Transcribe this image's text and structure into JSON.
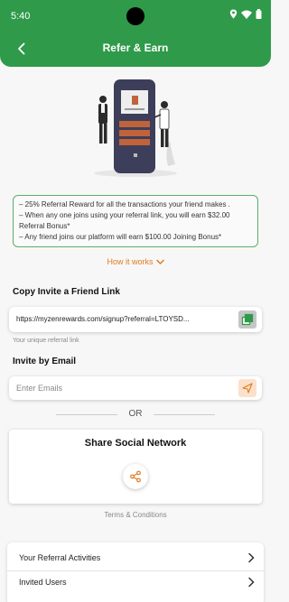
{
  "status_bar": {
    "time": "5:40"
  },
  "header": {
    "title": "Refer & Earn"
  },
  "info_lines": [
    "– 25% Referral Reward for all the transactions your friend makes .",
    "– When any one joins using your referral link, you will earn  $32.00",
    "Referral Bonus*",
    "– Any friend joins our platform will earn $100.00 Joining Bonus*"
  ],
  "how_it_works": {
    "label": "How it works"
  },
  "copy_link": {
    "section_label": "Copy Invite a Friend Link",
    "url": "https://myzenrewards.com/signup?referral=LTOYSD...",
    "helper": "Your unique referral link"
  },
  "invite_email": {
    "section_label": "Invite by Email",
    "placeholder": "Enter Emails"
  },
  "divider": {
    "label": "OR"
  },
  "social": {
    "title": "Share Social Network"
  },
  "terms": {
    "label": "Terms & Conditions"
  },
  "menu_items": [
    {
      "label": "Your Referral Activities"
    },
    {
      "label": "Invited Users"
    }
  ],
  "colors": {
    "brand_green": "#2f9a4a",
    "accent_orange": "#e07a20"
  },
  "icons": [
    "back-arrow-icon",
    "chevron-down-icon",
    "copy-icon",
    "send-icon",
    "share-icon",
    "chevron-right-icon"
  ]
}
